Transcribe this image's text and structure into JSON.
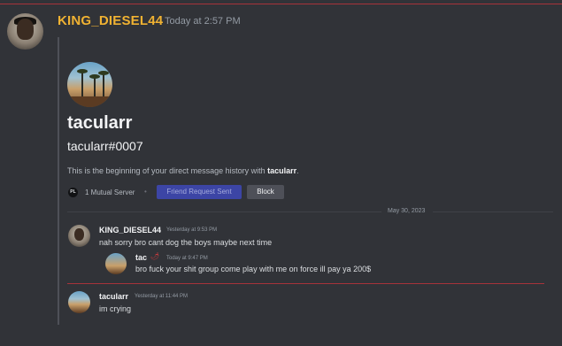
{
  "header": {
    "username": "KING_DIESEL44",
    "timestamp": "Today at 2:57 PM"
  },
  "embed": {
    "display_name": "tacularr",
    "tag": "tacularr#0007",
    "description_prefix": "This is the beginning of your direct message history with ",
    "description_user": "tacularr",
    "description_suffix": ".",
    "mutual_icon": "PL",
    "mutual_servers": "1 Mutual Server",
    "separator": "•",
    "friend_request_button": "Friend Request Sent",
    "block_button": "Block"
  },
  "date_divider": "May 30, 2023",
  "messages": [
    {
      "author": "KING_DIESEL44",
      "time": "Yesterday at 9:53 PM",
      "text": "nah sorry bro cant dog the boys maybe next time"
    },
    {
      "author": "tac",
      "badge": "🌶",
      "time": "Today at 9:47 PM",
      "text": "bro fuck your shit group come play with me on force ill pay ya 200$"
    },
    {
      "author": "tacularr",
      "time": "Yesterday at 11:44 PM",
      "text": "im crying"
    }
  ],
  "colors": {
    "background": "#313338",
    "username_accent": "#f0b232",
    "friend_button": "#3c45a5",
    "block_button": "#4e5058",
    "divider_red": "#a6333a"
  }
}
